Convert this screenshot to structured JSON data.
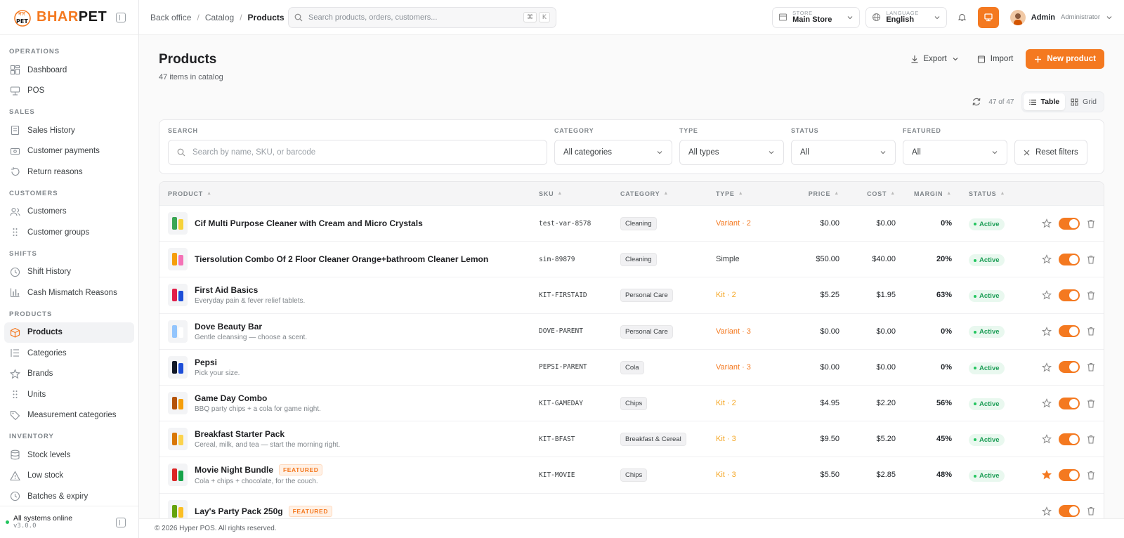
{
  "brand": {
    "name_a": "BHAR",
    "name_b": "PET",
    "badge_top": "भार",
    "badge_bottom": "PET",
    "accent": "#f47920"
  },
  "sidebar": {
    "sections": [
      {
        "title": "OPERATIONS",
        "items": [
          {
            "label": "Dashboard",
            "icon": "dashboard-icon"
          },
          {
            "label": "POS",
            "icon": "pos-icon"
          }
        ]
      },
      {
        "title": "SALES",
        "items": [
          {
            "label": "Sales History",
            "icon": "receipt-icon"
          },
          {
            "label": "Customer payments",
            "icon": "payment-icon"
          },
          {
            "label": "Return reasons",
            "icon": "undo-icon"
          }
        ]
      },
      {
        "title": "CUSTOMERS",
        "items": [
          {
            "label": "Customers",
            "icon": "users-icon"
          },
          {
            "label": "Customer groups",
            "icon": "grip-icon"
          }
        ]
      },
      {
        "title": "SHIFTS",
        "items": [
          {
            "label": "Shift History",
            "icon": "clock-icon"
          },
          {
            "label": "Cash Mismatch Reasons",
            "icon": "bar-chart-icon"
          }
        ]
      },
      {
        "title": "PRODUCTS",
        "items": [
          {
            "label": "Products",
            "icon": "box-icon",
            "active": true
          },
          {
            "label": "Categories",
            "icon": "list-tree-icon"
          },
          {
            "label": "Brands",
            "icon": "star-icon"
          },
          {
            "label": "Units",
            "icon": "grip-icon"
          },
          {
            "label": "Measurement categories",
            "icon": "tag-icon"
          }
        ]
      },
      {
        "title": "INVENTORY",
        "items": [
          {
            "label": "Stock levels",
            "icon": "database-icon"
          },
          {
            "label": "Low stock",
            "icon": "warning-icon"
          },
          {
            "label": "Batches & expiry",
            "icon": "clock-icon"
          }
        ]
      }
    ],
    "footer": {
      "status": "All systems online",
      "version": "v3.0.0"
    }
  },
  "topbar": {
    "breadcrumb": [
      "Back office",
      "Catalog",
      "Products"
    ],
    "search_placeholder": "Search products, orders, customers...",
    "kbd": [
      "⌘",
      "K"
    ],
    "store_label": "STORE",
    "store_value": "Main Store",
    "language_label": "LANGUAGE",
    "language_value": "English",
    "user_name": "Admin",
    "user_role": "Administrator"
  },
  "page": {
    "title": "Products",
    "subtitle": "47 items in catalog",
    "export_label": "Export",
    "import_label": "Import",
    "new_label": "New product",
    "count": "47 of 47",
    "view_table": "Table",
    "view_grid": "Grid"
  },
  "filters": {
    "search_label": "SEARCH",
    "search_placeholder": "Search by name, SKU, or barcode",
    "category_label": "CATEGORY",
    "category_value": "All categories",
    "type_label": "TYPE",
    "type_value": "All types",
    "status_label": "STATUS",
    "status_value": "All",
    "featured_label": "FEATURED",
    "featured_value": "All",
    "reset_label": "Reset filters"
  },
  "table": {
    "columns": [
      "PRODUCT",
      "SKU",
      "CATEGORY",
      "TYPE",
      "PRICE",
      "COST",
      "MARGIN",
      "STATUS"
    ],
    "rows": [
      {
        "name": "Cif Multi Purpose Cleaner with Cream and Micro Crystals",
        "desc": "",
        "featured": false,
        "sku": "test-var-8578",
        "category": "Cleaning",
        "type": "Variant · 2",
        "type_kind": "variant",
        "price": "$0.00",
        "cost": "$0.00",
        "margin": "0%",
        "status": "Active",
        "starred": false
      },
      {
        "name": "Tiersolution Combo Of 2 Floor Cleaner Orange+bathroom Cleaner Lemon",
        "desc": "",
        "featured": false,
        "sku": "sim-89879",
        "category": "Cleaning",
        "type": "Simple",
        "type_kind": "simple",
        "price": "$50.00",
        "cost": "$40.00",
        "margin": "20%",
        "status": "Active",
        "starred": false
      },
      {
        "name": "First Aid Basics",
        "desc": "Everyday pain & fever relief tablets.",
        "featured": false,
        "sku": "KIT-FIRSTAID",
        "category": "Personal Care",
        "type": "Kit · 2",
        "type_kind": "kit",
        "price": "$5.25",
        "cost": "$1.95",
        "margin": "63%",
        "status": "Active",
        "starred": false
      },
      {
        "name": "Dove Beauty Bar",
        "desc": "Gentle cleansing — choose a scent.",
        "featured": false,
        "sku": "DOVE-PARENT",
        "category": "Personal Care",
        "type": "Variant · 3",
        "type_kind": "variant",
        "price": "$0.00",
        "cost": "$0.00",
        "margin": "0%",
        "status": "Active",
        "starred": false
      },
      {
        "name": "Pepsi",
        "desc": "Pick your size.",
        "featured": false,
        "sku": "PEPSI-PARENT",
        "category": "Cola",
        "type": "Variant · 3",
        "type_kind": "variant",
        "price": "$0.00",
        "cost": "$0.00",
        "margin": "0%",
        "status": "Active",
        "starred": false
      },
      {
        "name": "Game Day Combo",
        "desc": "BBQ party chips + a cola for game night.",
        "featured": false,
        "sku": "KIT-GAMEDAY",
        "category": "Chips",
        "type": "Kit · 2",
        "type_kind": "kit",
        "price": "$4.95",
        "cost": "$2.20",
        "margin": "56%",
        "status": "Active",
        "starred": false
      },
      {
        "name": "Breakfast Starter Pack",
        "desc": "Cereal, milk, and tea — start the morning right.",
        "featured": false,
        "sku": "KIT-BFAST",
        "category": "Breakfast & Cereal",
        "type": "Kit · 3",
        "type_kind": "kit",
        "price": "$9.50",
        "cost": "$5.20",
        "margin": "45%",
        "status": "Active",
        "starred": false
      },
      {
        "name": "Movie Night Bundle",
        "desc": "Cola + chips + chocolate, for the couch.",
        "featured": true,
        "sku": "KIT-MOVIE",
        "category": "Chips",
        "type": "Kit · 3",
        "type_kind": "kit",
        "price": "$5.50",
        "cost": "$2.85",
        "margin": "48%",
        "status": "Active",
        "starred": true
      },
      {
        "name": "Lay's Party Pack 250g",
        "desc": "",
        "featured": true,
        "sku": "",
        "category": "",
        "type": "",
        "type_kind": "kit",
        "price": "",
        "cost": "",
        "margin": "",
        "status": "",
        "starred": false
      }
    ],
    "featured_badge": "FEATURED"
  },
  "footer": {
    "copyright": "© 2026 Hyper POS. All rights reserved."
  }
}
